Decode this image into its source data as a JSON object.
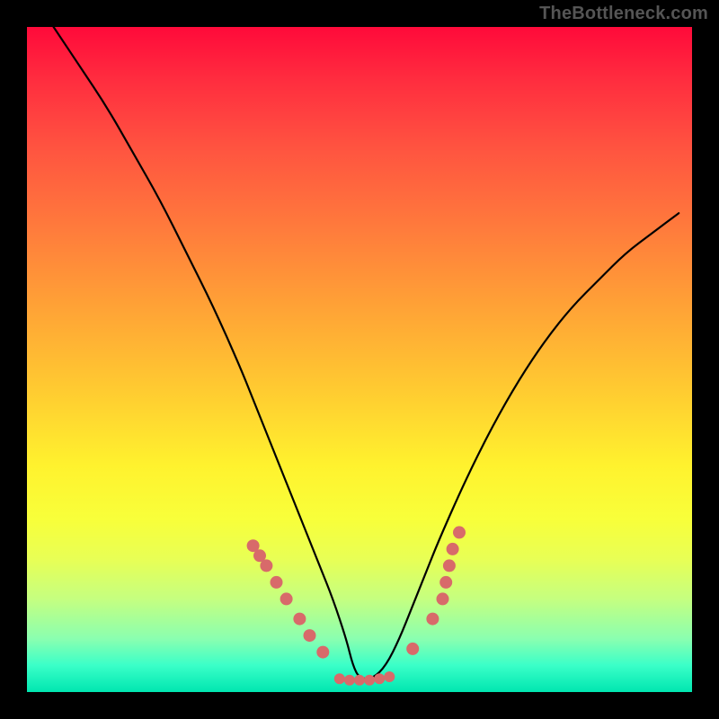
{
  "watermark": "TheBottleneck.com",
  "chart_data": {
    "type": "line",
    "title": "",
    "xlabel": "",
    "ylabel": "",
    "xlim": [
      0,
      100
    ],
    "ylim": [
      0,
      100
    ],
    "grid": false,
    "legend": false,
    "series": [
      {
        "name": "curve",
        "x": [
          4,
          8,
          12,
          16,
          20,
          24,
          28,
          32,
          34,
          36,
          38,
          40,
          42,
          44,
          46,
          48,
          49,
          50,
          52,
          54,
          56,
          58,
          60,
          62,
          66,
          70,
          74,
          78,
          82,
          86,
          90,
          94,
          98
        ],
        "y": [
          100,
          94,
          88,
          81,
          74,
          66,
          58,
          49,
          44,
          39,
          34,
          29,
          24,
          19,
          14,
          8,
          4,
          2,
          2,
          4,
          8,
          13,
          18,
          23,
          32,
          40,
          47,
          53,
          58,
          62,
          66,
          69,
          72
        ]
      }
    ],
    "points_left": [
      {
        "x": 34.0,
        "y": 22.0
      },
      {
        "x": 35.0,
        "y": 20.5
      },
      {
        "x": 36.0,
        "y": 19.0
      },
      {
        "x": 37.5,
        "y": 16.5
      },
      {
        "x": 39.0,
        "y": 14.0
      },
      {
        "x": 41.0,
        "y": 11.0
      },
      {
        "x": 42.5,
        "y": 8.5
      },
      {
        "x": 44.5,
        "y": 6.0
      }
    ],
    "points_bottom": [
      {
        "x": 47.0,
        "y": 2.0
      },
      {
        "x": 48.5,
        "y": 1.8
      },
      {
        "x": 50.0,
        "y": 1.8
      },
      {
        "x": 51.5,
        "y": 1.8
      },
      {
        "x": 53.0,
        "y": 2.0
      },
      {
        "x": 54.5,
        "y": 2.3
      }
    ],
    "points_right": [
      {
        "x": 58.0,
        "y": 6.5
      },
      {
        "x": 61.0,
        "y": 11.0
      },
      {
        "x": 62.5,
        "y": 14.0
      },
      {
        "x": 63.0,
        "y": 16.5
      },
      {
        "x": 63.5,
        "y": 19.0
      },
      {
        "x": 64.0,
        "y": 21.5
      },
      {
        "x": 65.0,
        "y": 24.0
      }
    ],
    "gradient_stops": [
      {
        "pos": 0.0,
        "color": "#ff0a3a"
      },
      {
        "pos": 0.18,
        "color": "#ff5340"
      },
      {
        "pos": 0.42,
        "color": "#ffa236"
      },
      {
        "pos": 0.66,
        "color": "#fff22e"
      },
      {
        "pos": 0.86,
        "color": "#c5ff80"
      },
      {
        "pos": 1.0,
        "color": "#00e6b0"
      }
    ]
  }
}
